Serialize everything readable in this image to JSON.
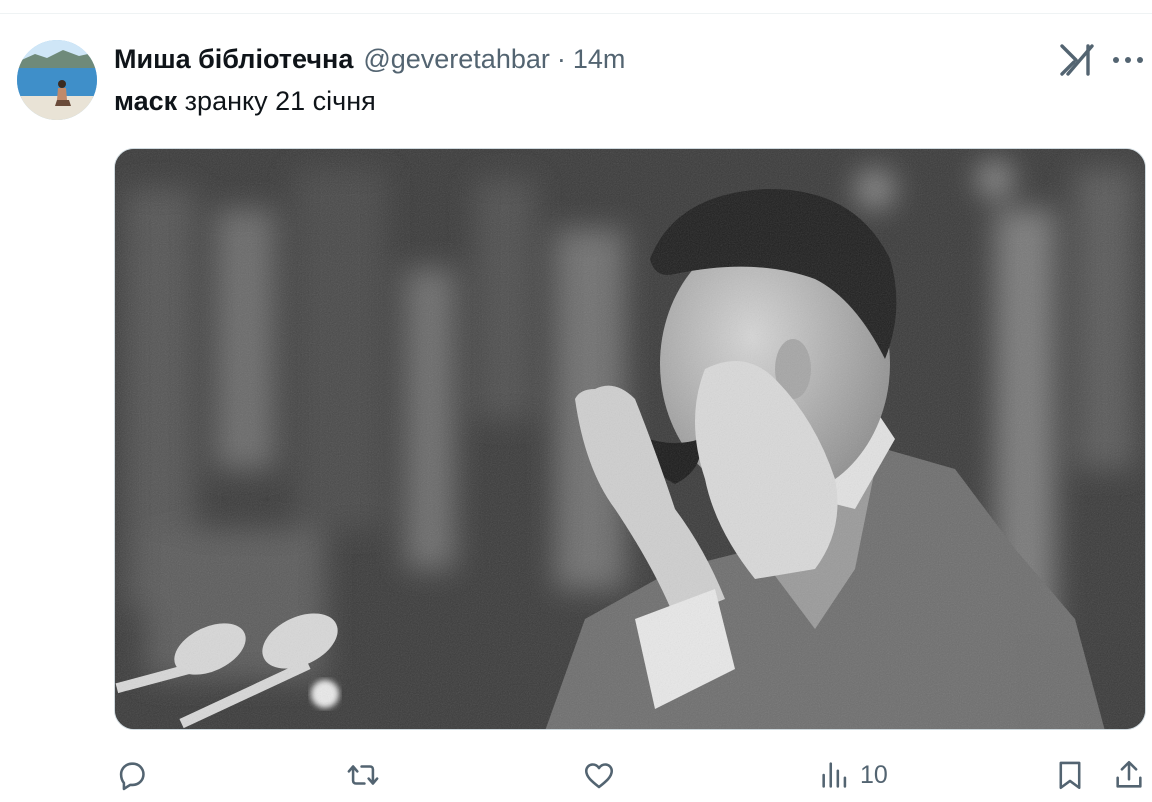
{
  "tweet": {
    "display_name": "Миша бібліотечна",
    "handle": "@geveretahbar",
    "separator": "·",
    "time": "14m",
    "text_bold": "маск",
    "text_rest": " зранку 21 січня"
  },
  "icons": {
    "grok": "grok-icon",
    "more": "more-icon",
    "reply": "reply-icon",
    "retweet": "retweet-icon",
    "like": "heart-icon",
    "views": "views-icon",
    "bookmark": "bookmark-icon",
    "share": "share-icon"
  },
  "actions": {
    "views_count": "10"
  },
  "colors": {
    "text": "#0f1419",
    "secondary": "#536471",
    "border": "#cfd9de"
  }
}
